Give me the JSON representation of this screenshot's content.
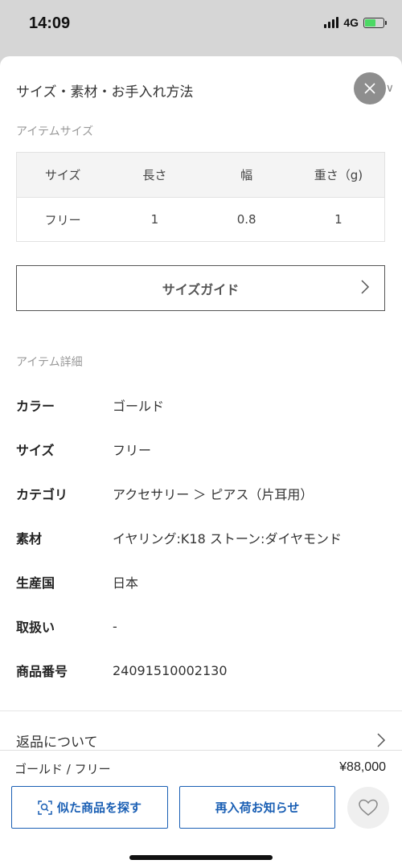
{
  "status": {
    "time": "14:09",
    "network": "4G"
  },
  "sheet": {
    "title": "サイズ・素材・お手入れ方法",
    "item_size_label": "アイテムサイズ",
    "size_table": {
      "headers": [
        "サイズ",
        "長さ",
        "幅",
        "重さ（g)"
      ],
      "rows": [
        [
          "フリー",
          "1",
          "0.8",
          "1"
        ]
      ]
    },
    "size_guide_label": "サイズガイド",
    "item_detail_label": "アイテム詳細",
    "details": [
      {
        "key": "カラー",
        "value": "ゴールド"
      },
      {
        "key": "サイズ",
        "value": "フリー"
      },
      {
        "key": "カテゴリ",
        "value": "アクセサリー ＞ ピアス（片耳用）"
      },
      {
        "key": "素材",
        "value": "イヤリング:K18 ストーン:ダイヤモンド"
      },
      {
        "key": "生産国",
        "value": "日本"
      },
      {
        "key": "取扱い",
        "value": "-"
      },
      {
        "key": "商品番号",
        "value": "24091510002130"
      }
    ],
    "returns_label": "返品について"
  },
  "bottom": {
    "variant": "ゴールド / フリー",
    "price": "¥88,000",
    "similar_label": "似た商品を探す",
    "restock_label": "再入荷お知らせ"
  },
  "colors": {
    "accent": "#1a5fb4",
    "close_bg": "#8e8e8e"
  },
  "icons": [
    "close-icon",
    "chevron-right-icon",
    "image-search-icon",
    "heart-icon",
    "battery-icon",
    "signal-icon"
  ]
}
